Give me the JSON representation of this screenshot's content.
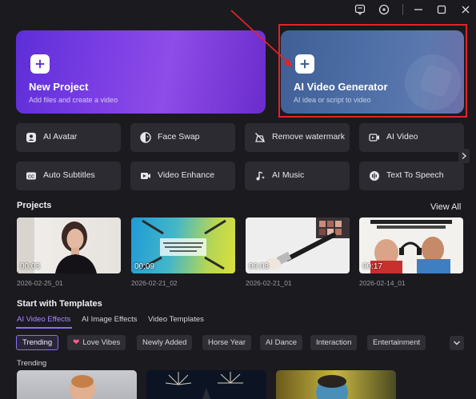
{
  "hero": {
    "new_project": {
      "title": "New Project",
      "subtitle": "Add files and create a video"
    },
    "ai_video_generator": {
      "title": "AI Video Generator",
      "subtitle": "AI idea or script to video"
    }
  },
  "tools": [
    {
      "label": "AI Avatar",
      "icon": "avatar-icon"
    },
    {
      "label": "Face Swap",
      "icon": "face-swap-icon"
    },
    {
      "label": "Remove watermark",
      "icon": "remove-watermark-icon"
    },
    {
      "label": "AI Video",
      "icon": "ai-video-icon"
    },
    {
      "label": "Auto Subtitles",
      "icon": "subtitles-icon"
    },
    {
      "label": "Video Enhance",
      "icon": "video-enhance-icon"
    },
    {
      "label": "AI Music",
      "icon": "music-icon"
    },
    {
      "label": "Text To Speech",
      "icon": "text-to-speech-icon"
    }
  ],
  "projects": {
    "title": "Projects",
    "view_all": "View All",
    "items": [
      {
        "duration": "00:03",
        "name": "2026-02-25_01"
      },
      {
        "duration": "00:09",
        "name": "2026-02-21_02"
      },
      {
        "duration": "00:03",
        "name": "2026-02-21_01"
      },
      {
        "duration": "00:17",
        "name": "2026-02-14_01"
      }
    ]
  },
  "templates": {
    "title": "Start with Templates",
    "tabs": [
      "AI Video Effects",
      "AI Image Effects",
      "Video Templates"
    ],
    "active_tab": "AI Video Effects",
    "chips": [
      "Trending",
      "Love Vibes",
      "Newly Added",
      "Horse Year",
      "AI Dance",
      "Interaction",
      "Entertainment"
    ],
    "active_chip": "Trending",
    "section_label": "Trending"
  },
  "colors": {
    "background": "#1b1a1f",
    "accent": "#8b6cf5",
    "annotation_red": "#e0242a"
  }
}
